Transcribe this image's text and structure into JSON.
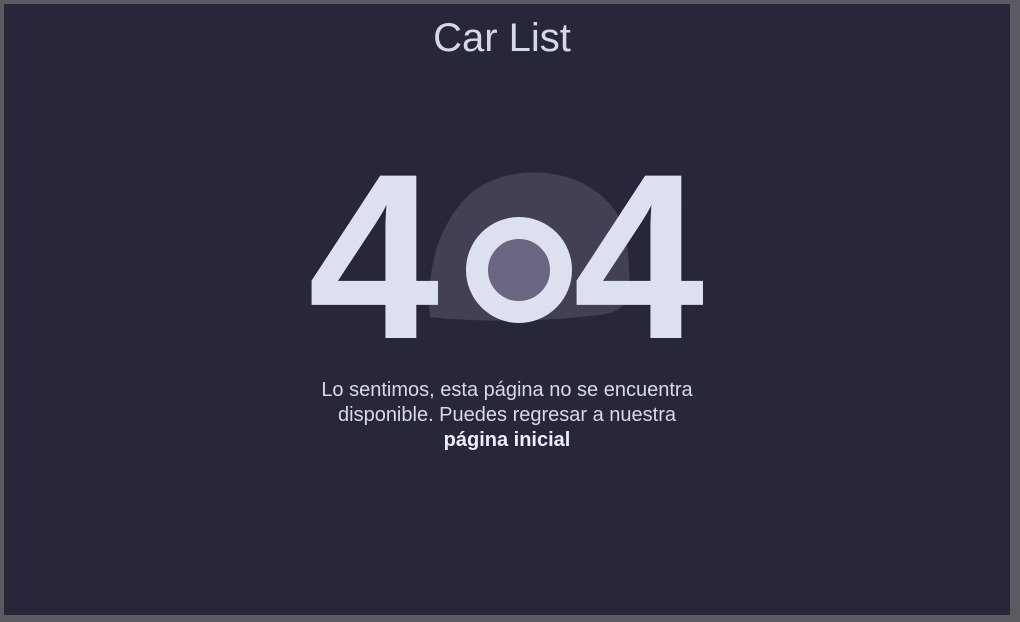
{
  "header": {
    "title": "Car List"
  },
  "error": {
    "code": "404",
    "message": "Lo sentimos, esta página no se encuentra disponible. Puedes regresar a nuestra",
    "home_link": "página inicial"
  },
  "colors": {
    "page_background": "#27263a",
    "outer_border": "#5a5a60",
    "digits": "#dde0ee",
    "helmet_shape": "#433f54",
    "ring_fill": "#6a6581",
    "text": "#d7d9e7"
  }
}
